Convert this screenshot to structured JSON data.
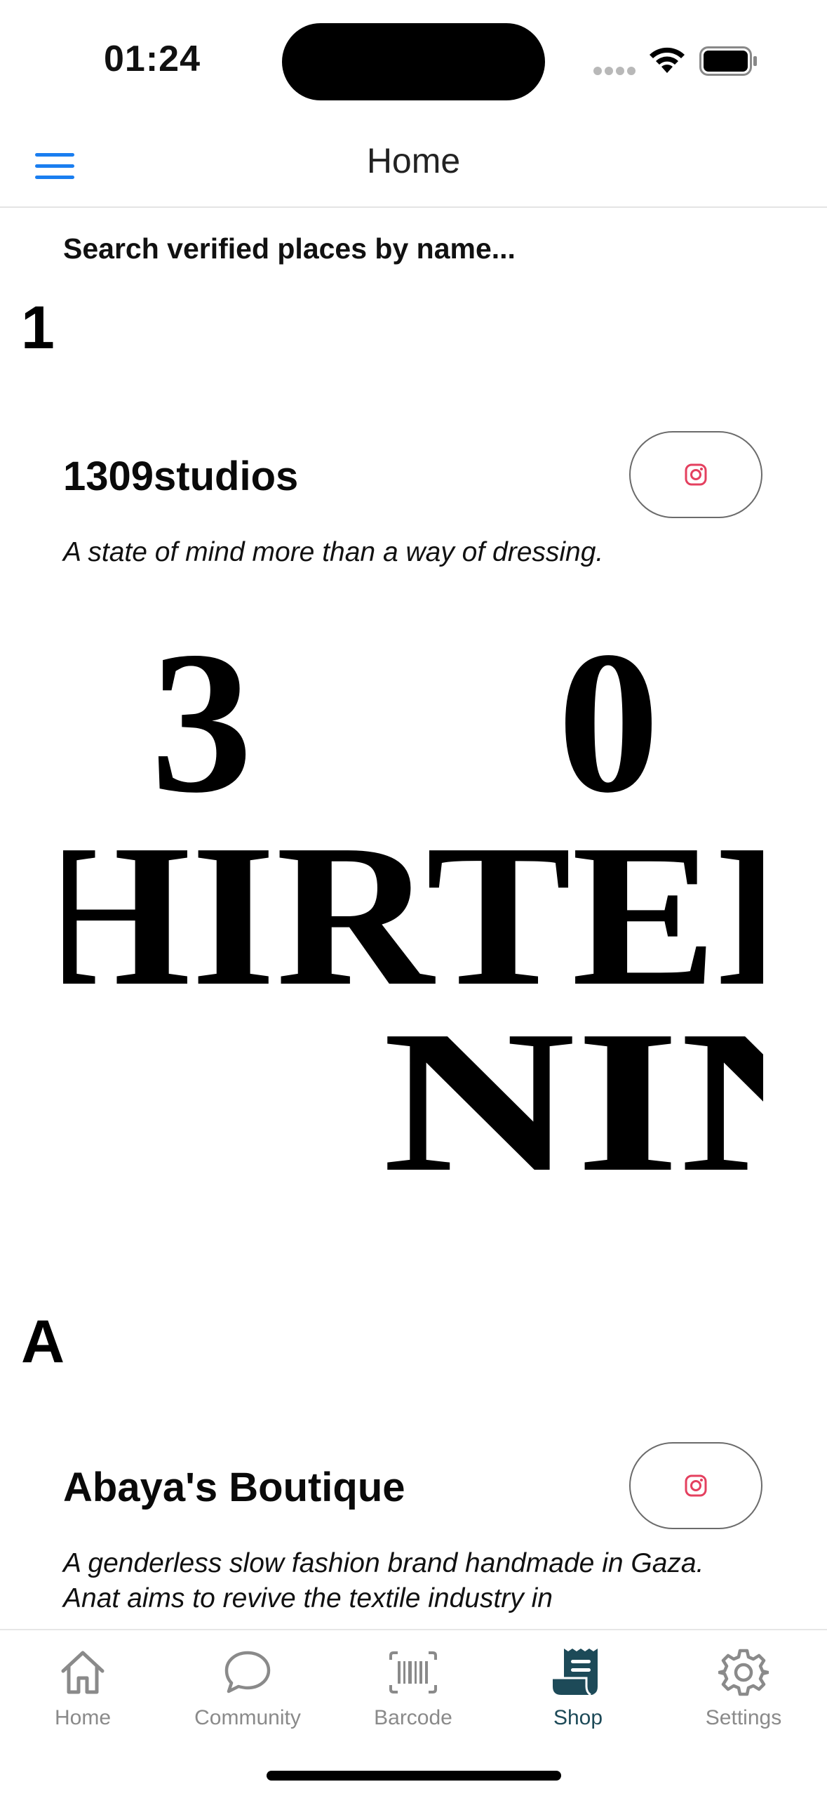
{
  "status_bar": {
    "time": "01:24"
  },
  "nav": {
    "title": "Home"
  },
  "search": {
    "placeholder": "Search verified places by name..."
  },
  "sections": [
    {
      "header": "1",
      "places": [
        {
          "name": "1309studios",
          "description": "A state of mind more than a way of dressing.",
          "logo": {
            "line1": "3      0",
            "line2": "HIRTEE",
            "line3": "NIN"
          }
        }
      ]
    },
    {
      "header": "A",
      "places": [
        {
          "name": "Abaya's Boutique",
          "description": "A genderless slow fashion brand handmade in Gaza. Anat aims to revive the textile industry in"
        }
      ]
    }
  ],
  "tabs": [
    {
      "label": "Home",
      "icon": "home-icon"
    },
    {
      "label": "Community",
      "icon": "chat-bubble-icon"
    },
    {
      "label": "Barcode",
      "icon": "barcode-icon"
    },
    {
      "label": "Shop",
      "icon": "receipt-icon",
      "active": true
    },
    {
      "label": "Settings",
      "icon": "gear-icon"
    }
  ],
  "colors": {
    "accent_blue": "#1a7ef0",
    "instagram_red": "#e4405f",
    "active_tab": "#1d4a58",
    "inactive_tab": "#8a8a8a"
  }
}
